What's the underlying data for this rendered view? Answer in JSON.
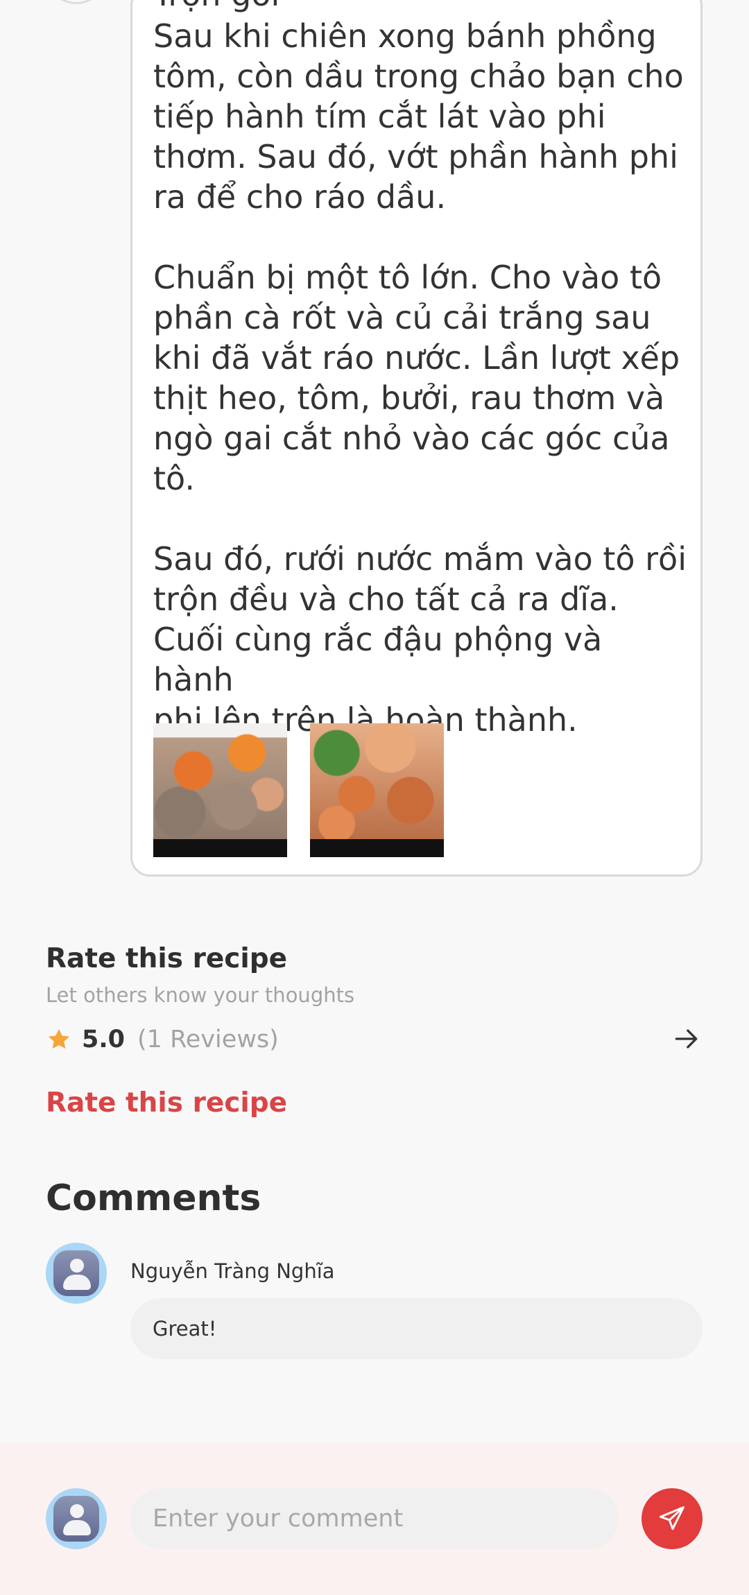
{
  "step": {
    "heading_cut": "Trộn gỏi",
    "text": "Sau khi chiên xong bánh phồng\ntôm, còn dầu trong chảo bạn cho\ntiếp hành tím cắt lát vào phi\nthơm. Sau đó, vớt phần hành phi\nra để cho ráo dầu.\n\nChuẩn bị một tô lớn. Cho vào tô\nphần cà rốt và củ cải trắng sau\nkhi đã vắt ráo nước. Lần lượt xếp\nthịt heo, tôm, bưởi, rau thơm và\nngò gai cắt nhỏ vào các góc của\ntô.\n\nSau đó, rưới nước mắm vào tô rồi\ntrộn đều và cho tất cả ra dĩa.\nCuối cùng rắc đậu phộng và hành\nphi lên trên là hoàn thành."
  },
  "rating": {
    "title": "Rate this recipe",
    "subtitle": "Let others know your thoughts",
    "value": "5.0",
    "count": "(1 Reviews)",
    "action_label": "Rate this recipe",
    "star_color": "#f5a637"
  },
  "comments": {
    "title": "Comments",
    "items": [
      {
        "author": "Nguyễn Tràng Nghĩa",
        "text": "Great!"
      }
    ]
  },
  "composer": {
    "placeholder": "Enter your comment",
    "send_color": "#e23c3c"
  },
  "colors": {
    "accent": "#d94545",
    "background": "#f8f8f9",
    "composer_bg": "#fcf1f1"
  }
}
